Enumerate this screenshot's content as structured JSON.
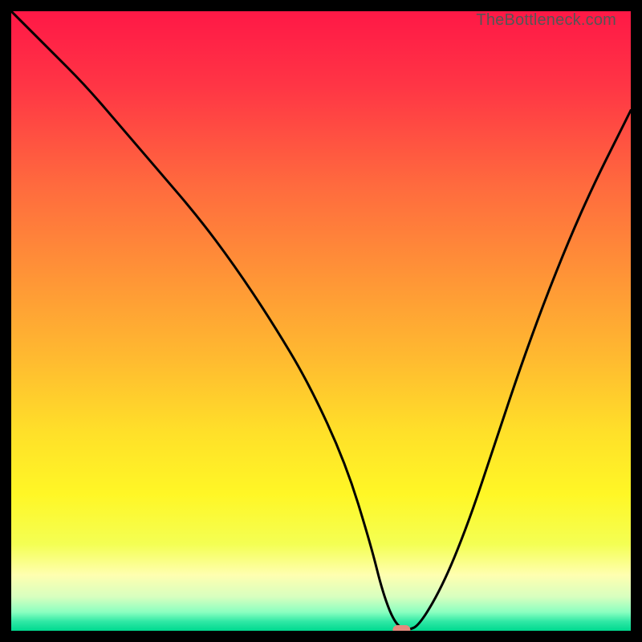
{
  "watermark": "TheBottleneck.com",
  "chart_data": {
    "type": "line",
    "title": "",
    "xlabel": "",
    "ylabel": "",
    "xlim": [
      0,
      100
    ],
    "ylim": [
      0,
      100
    ],
    "grid": false,
    "legend": false,
    "series": [
      {
        "name": "bottleneck-curve",
        "color": "#000000",
        "x": [
          0,
          6,
          12,
          18,
          24,
          30,
          36,
          42,
          48,
          54,
          58,
          60,
          62,
          64,
          66,
          70,
          74,
          78,
          82,
          86,
          90,
          94,
          98,
          100
        ],
        "y": [
          100,
          94,
          88,
          81,
          74,
          67,
          59,
          50,
          40,
          27,
          14,
          6,
          1,
          0,
          1,
          8,
          18,
          30,
          42,
          53,
          63,
          72,
          80,
          84
        ]
      }
    ],
    "marker": {
      "name": "optimal-point",
      "x": 63,
      "y": 0,
      "color": "#e48a7d",
      "shape": "pill"
    },
    "background_gradient": {
      "stops": [
        {
          "offset": 0.0,
          "color": "#ff1846"
        },
        {
          "offset": 0.12,
          "color": "#ff3545"
        },
        {
          "offset": 0.28,
          "color": "#ff6a3e"
        },
        {
          "offset": 0.42,
          "color": "#ff9237"
        },
        {
          "offset": 0.56,
          "color": "#ffba30"
        },
        {
          "offset": 0.68,
          "color": "#ffe029"
        },
        {
          "offset": 0.78,
          "color": "#fff726"
        },
        {
          "offset": 0.86,
          "color": "#f4ff53"
        },
        {
          "offset": 0.91,
          "color": "#ffffb0"
        },
        {
          "offset": 0.945,
          "color": "#d8ffbf"
        },
        {
          "offset": 0.97,
          "color": "#8affc0"
        },
        {
          "offset": 0.985,
          "color": "#30e8a5"
        },
        {
          "offset": 1.0,
          "color": "#00d98f"
        }
      ]
    }
  }
}
